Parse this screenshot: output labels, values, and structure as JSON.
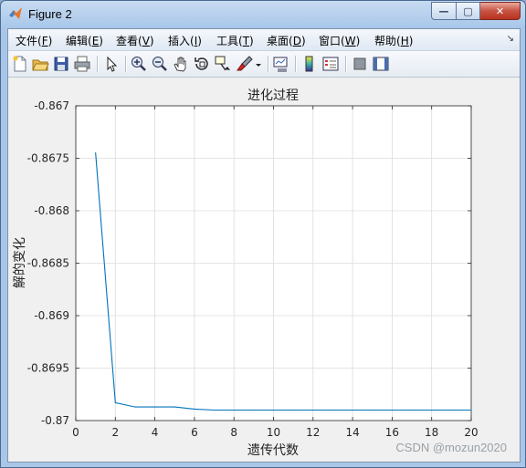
{
  "window": {
    "title": "Figure 2",
    "buttons": {
      "minimize": "—",
      "maximize": "▢",
      "close": "✕"
    }
  },
  "menu": [
    {
      "label": "文件",
      "key": "F"
    },
    {
      "label": "编辑",
      "key": "E"
    },
    {
      "label": "查看",
      "key": "V"
    },
    {
      "label": "插入",
      "key": "I"
    },
    {
      "label": "工具",
      "key": "T"
    },
    {
      "label": "桌面",
      "key": "D"
    },
    {
      "label": "窗口",
      "key": "W"
    },
    {
      "label": "帮助",
      "key": "H"
    }
  ],
  "toolbar": [
    "new-figure-icon",
    "open-file-icon",
    "save-icon",
    "print-icon",
    "edit-plot-icon",
    "zoom-in-icon",
    "zoom-out-icon",
    "pan-icon",
    "rotate-3d-icon",
    "data-cursor-icon",
    "brush-icon",
    "brush-dropdown-icon",
    "link-plot-icon",
    "insert-colorbar-icon",
    "insert-legend-icon",
    "hide-plot-tools-icon",
    "show-plot-tools-icon"
  ],
  "chart_data": {
    "type": "line",
    "title": "进化过程",
    "xlabel": "遗传代数",
    "ylabel": "解的变化",
    "xlim": [
      0,
      20
    ],
    "ylim": [
      -0.87,
      -0.867
    ],
    "xticks": [
      0,
      2,
      4,
      6,
      8,
      10,
      12,
      14,
      16,
      18,
      20
    ],
    "yticks": [
      -0.867,
      -0.8675,
      -0.868,
      -0.8685,
      -0.869,
      -0.8695,
      -0.87
    ],
    "ytick_labels": [
      "-0.867",
      "-0.8675",
      "-0.868",
      "-0.8685",
      "-0.869",
      "-0.8695",
      "-0.87"
    ],
    "grid": true,
    "series": [
      {
        "color": "#0072bd",
        "x": [
          1,
          2,
          3,
          4,
          5,
          6,
          7,
          8,
          9,
          10,
          11,
          12,
          13,
          14,
          15,
          16,
          17,
          18,
          19,
          20
        ],
        "y": [
          -0.86745,
          -0.86983,
          -0.86987,
          -0.86987,
          -0.86987,
          -0.86989,
          -0.8699,
          -0.8699,
          -0.8699,
          -0.8699,
          -0.8699,
          -0.8699,
          -0.8699,
          -0.8699,
          -0.8699,
          -0.8699,
          -0.8699,
          -0.8699,
          -0.8699,
          -0.8699
        ]
      }
    ]
  },
  "watermark": "CSDN @mozun2020"
}
